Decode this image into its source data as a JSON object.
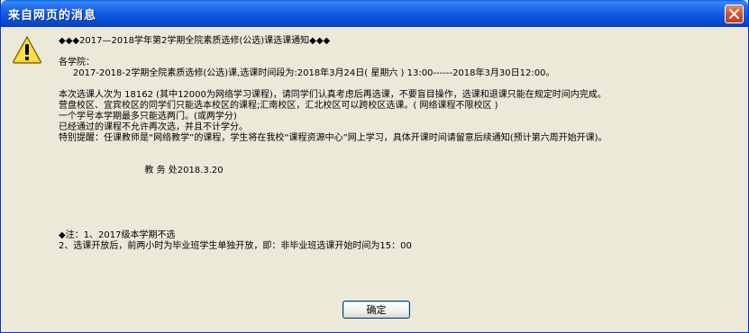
{
  "window": {
    "title": "来自网页的消息"
  },
  "dialog": {
    "lines": [
      "◆◆◆2017—2018学年第2学期全院素质选修(公选)课选课通知◆◆◆",
      "",
      "各学院：",
      "     2017-2018-2学期全院素质选修(公选)课,选课时间段为:2018年3月24日( 星期六 ) 13:00------2018年3月30日12:00。",
      "",
      "本次选课人次为 18162 (其中12000为网络学习课程)，请同学们认真考虑后再选课，不要盲目操作，选课和退课只能在规定时间内完成。",
      "营盘校区、宜宾校区的同学们只能选本校区的课程;汇南校区，汇北校区可以跨校区选课。( 网络课程不限校区 )",
      "一个学号本学期最多只能选两门。(或两学分)",
      "已经通过的课程不允许再次选，并且不计学分。",
      "特别提醒：任课教师是“网络教学”的课程，学生将在我校“课程资源中心”网上学习，具体开课时间请留意后续通知(预计第六周开始开课)。",
      "",
      "",
      "                              教 务 处2018.3.20",
      "",
      "",
      "",
      "",
      "",
      "◆注：1、2017级本学期不选",
      "2、选课开放后，前两小时为毕业班学生单独开放，即：非毕业班选课开始时间为15：00"
    ],
    "ok_label": "确定"
  },
  "icons": {
    "close": "close-icon",
    "warning": "warning-icon"
  },
  "colors": {
    "titlebar": "#0a55e0",
    "background": "#ece9d8",
    "close_button": "#d4512a",
    "warning_fill": "#f7d51d"
  }
}
